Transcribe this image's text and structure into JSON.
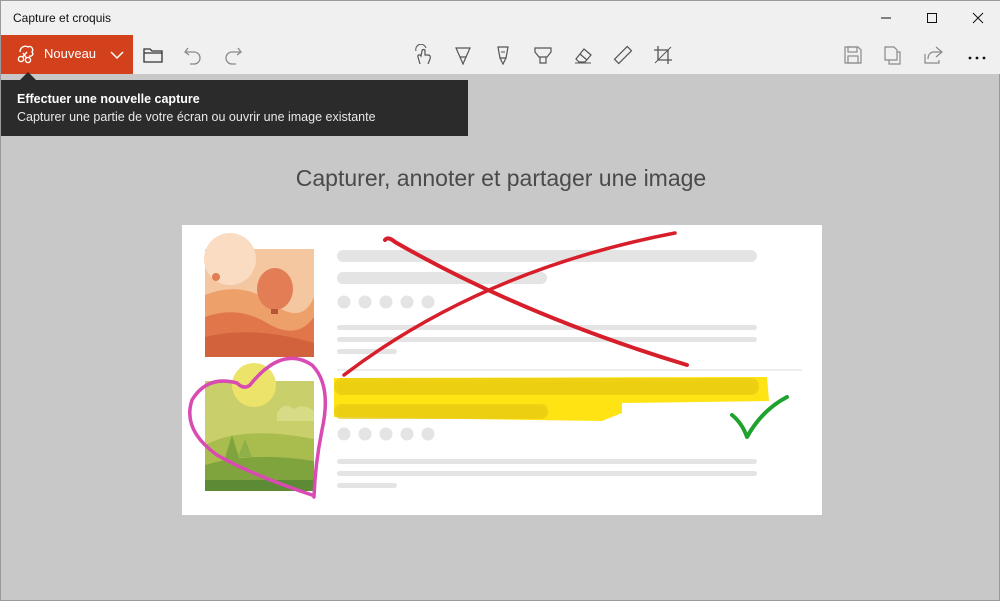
{
  "window": {
    "title": "Capture et croquis"
  },
  "toolbar": {
    "new_label": "Nouveau",
    "icons": [
      "open-folder-icon",
      "undo-icon",
      "redo-icon",
      "touch-writing-icon",
      "ballpoint-pen-icon",
      "pencil-icon",
      "highlighter-icon",
      "eraser-icon",
      "ruler-icon",
      "crop-icon",
      "save-icon",
      "copy-icon",
      "share-icon",
      "more-icon"
    ]
  },
  "tooltip": {
    "title": "Effectuer une nouvelle capture",
    "description": "Capturer une partie de votre écran ou ouvrir une image existante"
  },
  "main": {
    "headline": "Capturer, annoter et partager une image"
  },
  "colors": {
    "accent": "#d2411c",
    "annotation_red": "#d71f2b",
    "annotation_yellow": "#ffe100",
    "annotation_pink": "#d94ab3",
    "annotation_green": "#1fa22e"
  }
}
